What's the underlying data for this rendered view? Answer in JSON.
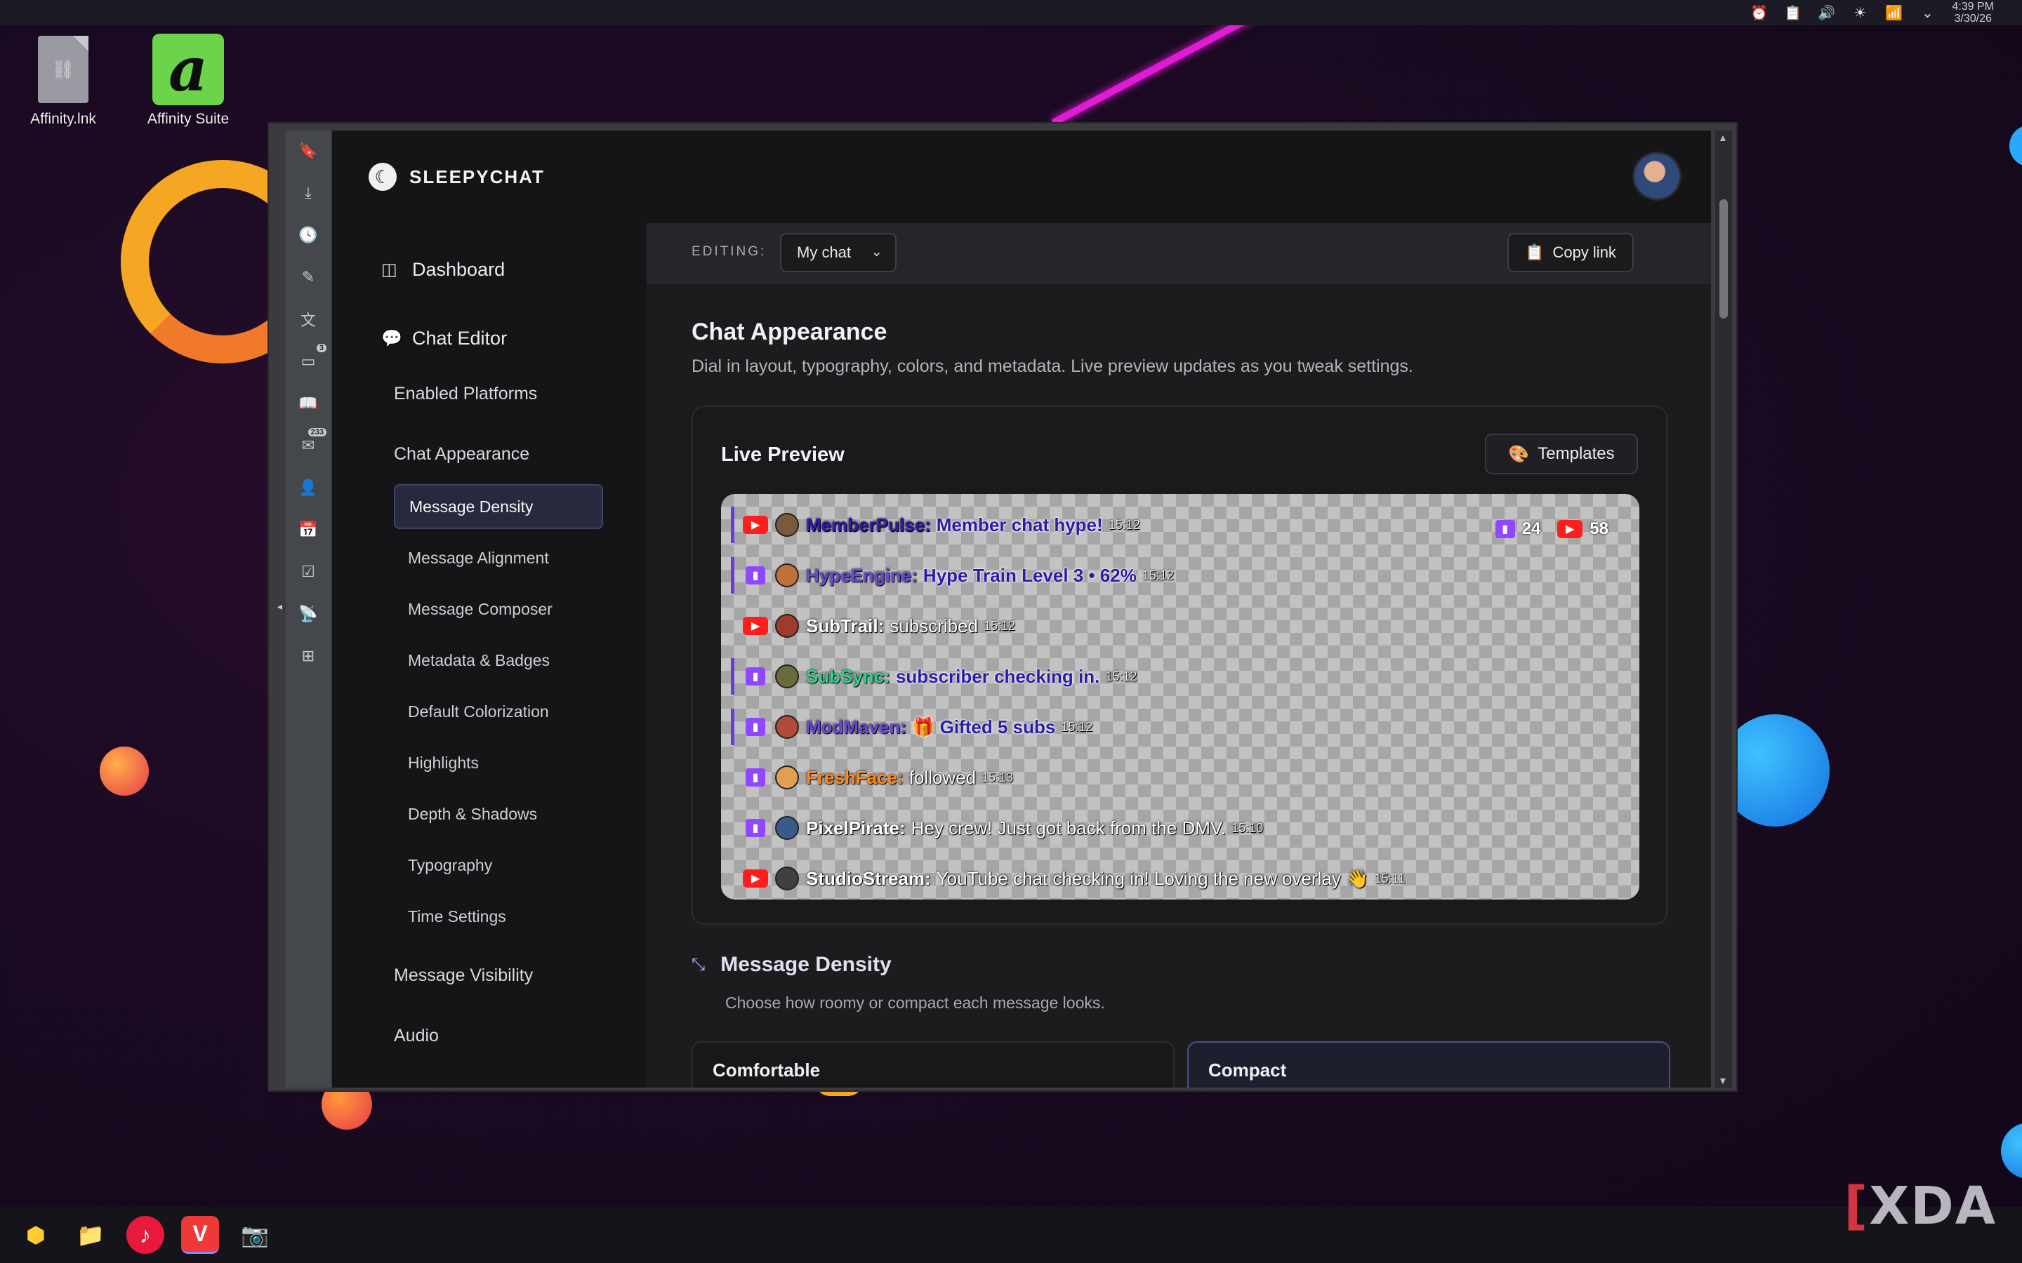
{
  "system": {
    "time": "4:39 PM",
    "date": "3/30/26"
  },
  "desktop": {
    "icons": [
      {
        "label": "Affinity.lnk"
      },
      {
        "label": "Affinity Suite"
      }
    ]
  },
  "app": {
    "brand": "SLEEPYCHAT",
    "nav": {
      "dashboard": "Dashboard",
      "chat_editor": "Chat Editor",
      "enabled_platforms": "Enabled Platforms",
      "chat_appearance": "Chat Appearance",
      "appearance_items": [
        {
          "label": "Message Density",
          "active": true
        },
        {
          "label": "Message Alignment"
        },
        {
          "label": "Message Composer"
        },
        {
          "label": "Metadata & Badges"
        },
        {
          "label": "Default Colorization"
        },
        {
          "label": "Highlights"
        },
        {
          "label": "Depth & Shadows"
        },
        {
          "label": "Typography"
        },
        {
          "label": "Time Settings"
        }
      ],
      "message_visibility": "Message Visibility",
      "audio": "Audio"
    },
    "editbar": {
      "editing_label": "EDITING:",
      "selected_chat": "My chat",
      "copy_link": "Copy link"
    },
    "section": {
      "title": "Chat Appearance",
      "description": "Dial in layout, typography, colors, and metadata. Live preview updates as you tweak settings."
    },
    "preview": {
      "title": "Live Preview",
      "templates_label": "Templates",
      "counts": {
        "twitch": "24",
        "youtube": "58"
      },
      "messages": [
        {
          "platform": "youtube",
          "user": "MemberPulse:",
          "user_color": "#2b1ca8",
          "text": "Member chat hype!",
          "time": "15:12",
          "highlight": true,
          "text_style": "purple"
        },
        {
          "platform": "twitch",
          "user": "HypeEngine:",
          "user_color": "#6a48d6",
          "text": "Hype Train Level 3 • 62%",
          "time": "15:12",
          "highlight": true,
          "text_style": "purple"
        },
        {
          "platform": "youtube",
          "user": "SubTrail:",
          "user_color": "#ffffff",
          "text": "subscribed",
          "time": "15:12",
          "highlight": false,
          "text_style": "plain"
        },
        {
          "platform": "twitch",
          "user": "SubSync:",
          "user_color": "#2ed48a",
          "text": "subscriber checking in.",
          "time": "15:12",
          "highlight": true,
          "text_style": "purple"
        },
        {
          "platform": "twitch",
          "user": "ModMaven:",
          "user_color": "#6a48d6",
          "text": "🎁 Gifted 5 subs",
          "time": "15:12",
          "highlight": true,
          "text_style": "purple"
        },
        {
          "platform": "twitch",
          "user": "FreshFace:",
          "user_color": "#ff8a1e",
          "text": "followed",
          "time": "15:13",
          "highlight": false,
          "text_style": "plain"
        },
        {
          "platform": "twitch",
          "user": "PixelPirate:",
          "user_color": "#ffffff",
          "text": "Hey crew! Just got back from the DMV.",
          "time": "15:10",
          "highlight": false,
          "text_style": "plain"
        },
        {
          "platform": "youtube",
          "user": "StudioStream:",
          "user_color": "#ffffff",
          "text": "YouTube chat checking in! Loving the new overlay 👋",
          "time": "15:11",
          "highlight": false,
          "text_style": "plain"
        }
      ]
    },
    "density": {
      "title": "Message Density",
      "description": "Choose how roomy or compact each message looks.",
      "options": [
        {
          "label": "Comfortable",
          "selected": false
        },
        {
          "label": "Compact",
          "selected": true
        }
      ]
    }
  },
  "watermark": {
    "text": "XDA"
  }
}
